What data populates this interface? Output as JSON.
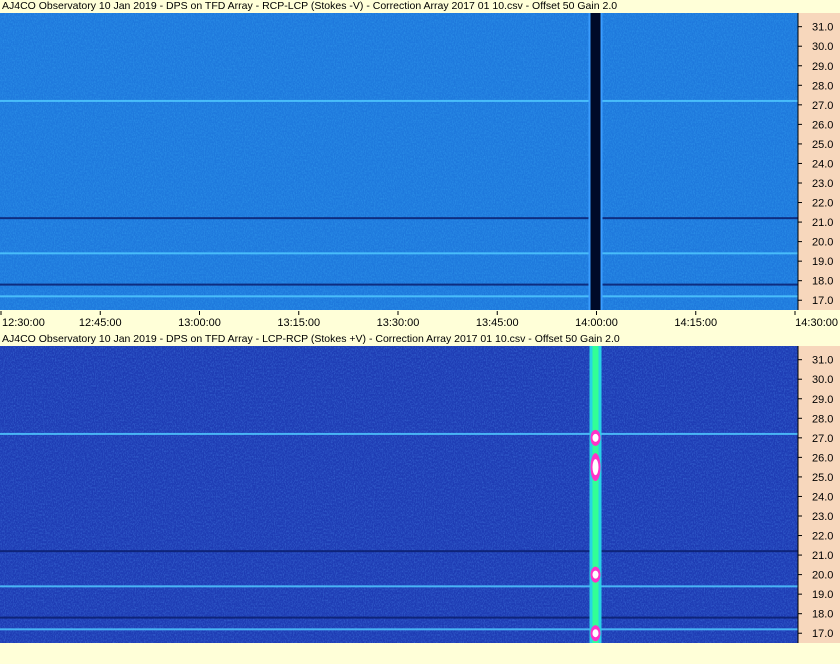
{
  "chart_data": [
    {
      "type": "heatmap",
      "title": "AJ4CO Observatory 10 Jan 2019  -  DPS on TFD Array  -  RCP-LCP (Stokes -V)  -  Correction Array 2017 01 10.csv  -  Offset 50  Gain 2.0",
      "x": {
        "ticks": [
          "12:30:00",
          "12:45:00",
          "13:00:00",
          "13:15:00",
          "13:30:00",
          "13:45:00",
          "14:00:00",
          "14:15:00",
          "14:30:00"
        ],
        "range": [
          "12:30:00",
          "14:30:00"
        ]
      },
      "y": {
        "ticks": [
          31.0,
          30.0,
          29.0,
          28.0,
          27.0,
          26.0,
          25.0,
          24.0,
          23.0,
          22.0,
          21.0,
          20.0,
          19.0,
          18.0,
          17.0
        ],
        "range": [
          16.5,
          31.7
        ]
      },
      "features": {
        "burst_time": "14:00:00",
        "burst_appearance": "dark (negative) vertical stripe across all frequencies",
        "persistent_bands": [
          17.2,
          17.8,
          27.2,
          21.2,
          19.4
        ]
      }
    },
    {
      "type": "heatmap",
      "title": "AJ4CO Observatory 10 Jan 2019  -  DPS on TFD Array  -  LCP-RCP (Stokes +V)  -  Correction Array 2017 01 10.csv  -  Offset 50  Gain 2.0",
      "x": {
        "ticks": [],
        "range": [
          "12:30:00",
          "14:30:00"
        ]
      },
      "y": {
        "ticks": [
          31.0,
          30.0,
          29.0,
          28.0,
          27.0,
          26.0,
          25.0,
          24.0,
          23.0,
          22.0,
          21.0,
          20.0,
          19.0,
          18.0,
          17.0
        ],
        "range": [
          16.5,
          31.7
        ]
      },
      "features": {
        "burst_time": "14:00:00",
        "burst_appearance": "bright (positive) vertical stripe, white/magenta peaks near 27, 25.5, 20 and 17 MHz",
        "persistent_bands": [
          17.2,
          17.8,
          27.2,
          21.2,
          19.4
        ]
      }
    }
  ],
  "colors": {
    "background": "#ffffd8",
    "axis_panel": "#f7d7bc",
    "top_base": "#1e78dc",
    "bottom_base": "#1e3cb4"
  }
}
